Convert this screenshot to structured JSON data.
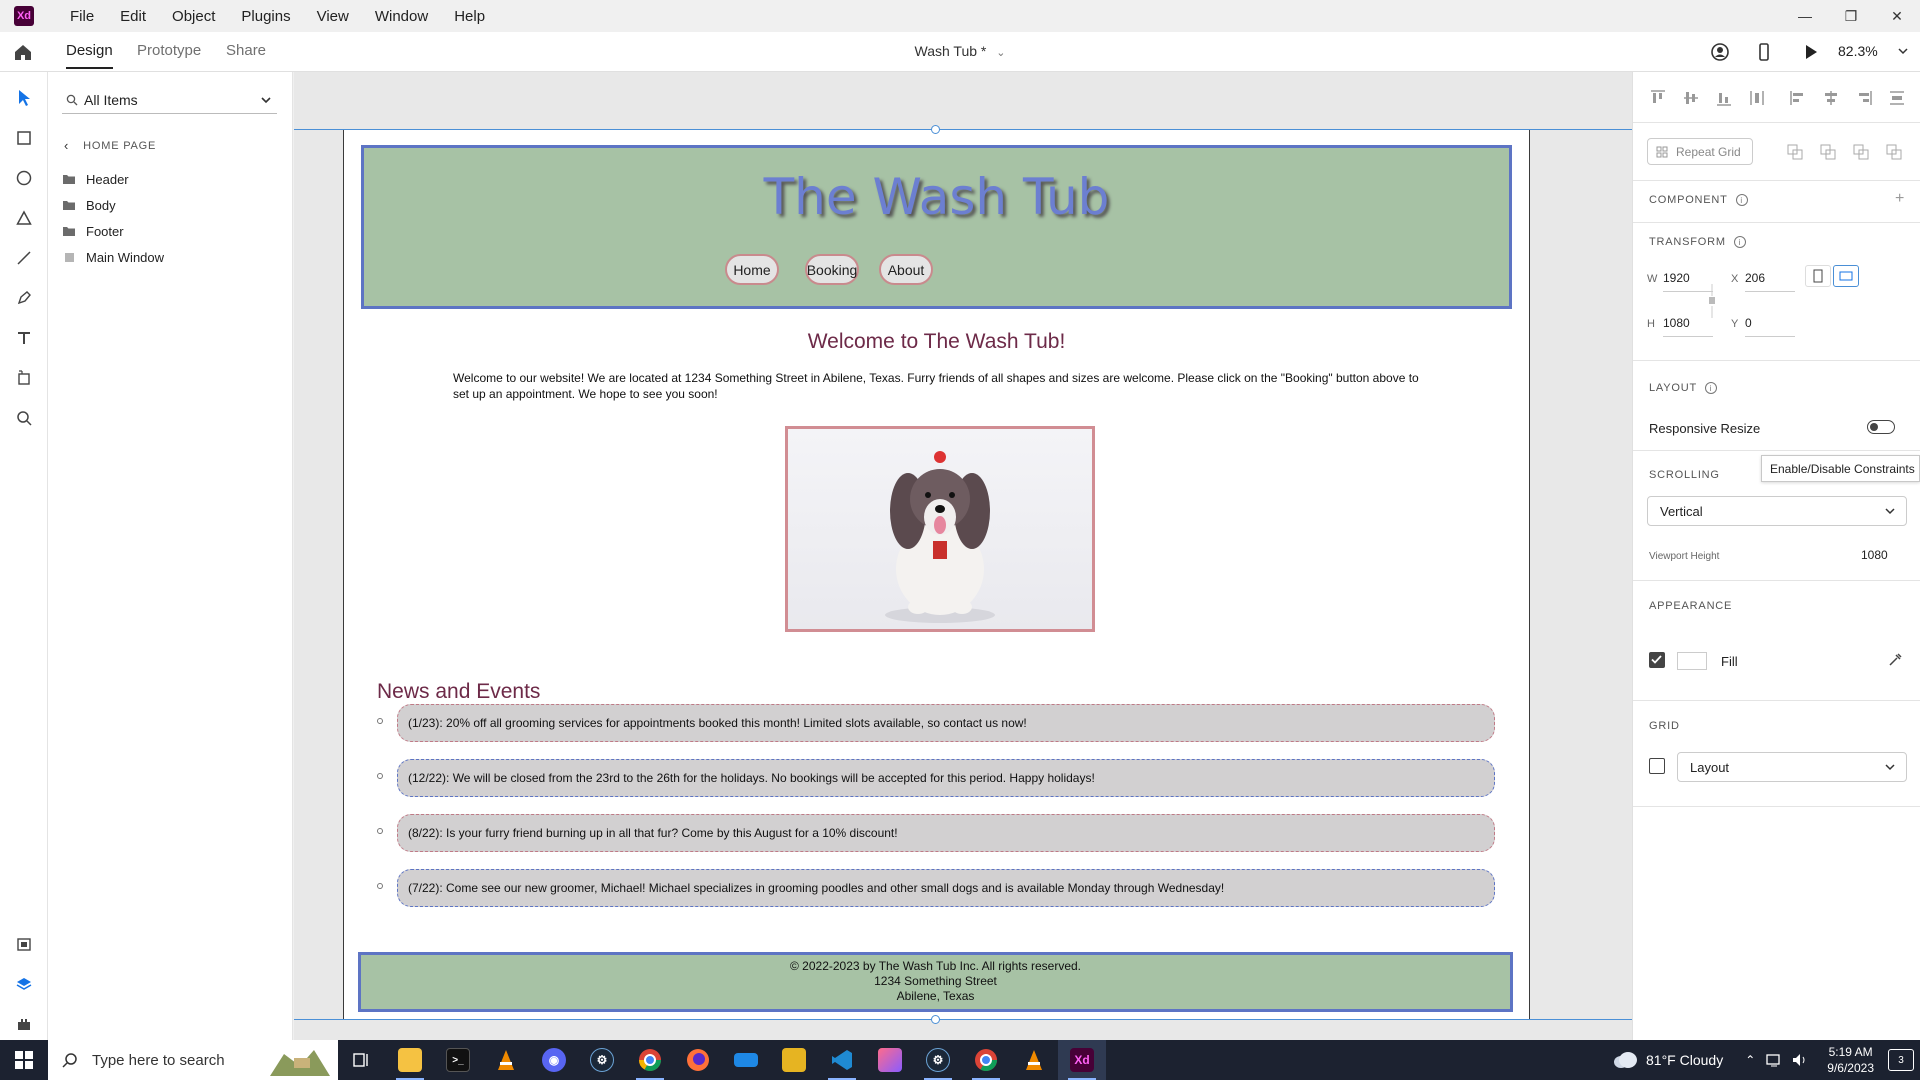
{
  "menubar": {
    "logo_text": "Xd",
    "items": [
      "File",
      "Edit",
      "Object",
      "Plugins",
      "View",
      "Window",
      "Help"
    ]
  },
  "toolbar": {
    "tabs": [
      "Design",
      "Prototype",
      "Share"
    ],
    "doc_title": "Wash Tub *",
    "zoom": "82.3%"
  },
  "layers": {
    "search_value": "All Items",
    "breadcrumb": "HOME PAGE",
    "items": [
      "Header",
      "Body",
      "Footer",
      "Main Window"
    ]
  },
  "site": {
    "title": "The Wash Tub",
    "nav": [
      "Home",
      "Booking",
      "About"
    ],
    "welcome_heading": "Welcome to The Wash Tub!",
    "welcome_text": "Welcome to our website! We are located at 1234 Something Street in Abilene, Texas. Furry friends of all shapes and sizes are welcome. Please click on the \"Booking\" button above to set up an appointment. We hope to see you soon!",
    "news_heading": "News and Events",
    "news": [
      "(1/23): 20% off all grooming services for appointments booked this month! Limited slots available, so contact us now!",
      "(12/22): We will be closed from the 23rd to the 26th for the holidays. No bookings will be accepted for this period. Happy holidays!",
      "(8/22): Is your furry friend burning up in all that fur? Come by this August for a 10% discount!",
      "(7/22): Come see our new groomer, Michael! Michael specializes in grooming poodles and other small dogs and is available Monday through Wednesday!"
    ],
    "footer_lines": [
      "© 2022-2023 by The Wash Tub Inc. All rights reserved.",
      "1234 Something Street",
      "Abilene, Texas"
    ]
  },
  "props": {
    "repeat_grid": "Repeat Grid",
    "component_label": "COMPONENT",
    "transform_label": "TRANSFORM",
    "w_key": "W",
    "w_val": "1920",
    "h_key": "H",
    "h_val": "1080",
    "x_key": "X",
    "x_val": "206",
    "y_key": "Y",
    "y_val": "0",
    "layout_label": "LAYOUT",
    "responsive_resize": "Responsive Resize",
    "responsive_on": false,
    "tooltip": "Enable/Disable Constraints",
    "scrolling_label": "SCROLLING",
    "scrolling_value": "Vertical",
    "viewport_label": "Viewport Height",
    "viewport_value": "1080",
    "appearance_label": "APPEARANCE",
    "fill_label": "Fill",
    "fill_checked": true,
    "grid_label": "GRID",
    "grid_value": "Layout",
    "grid_checked": false
  },
  "taskbar": {
    "search_placeholder": "Type here to search",
    "weather": "81°F  Cloudy",
    "time": "5:19 AM",
    "date": "9/6/2023",
    "notif_count": "3"
  },
  "colors": {
    "header_green": "#a7c2a5",
    "border_blue": "#5d74c4",
    "heading_maroon": "#6d2a48",
    "nav_border_pink": "#c98a8d",
    "selection_blue": "#4a8fd6"
  }
}
